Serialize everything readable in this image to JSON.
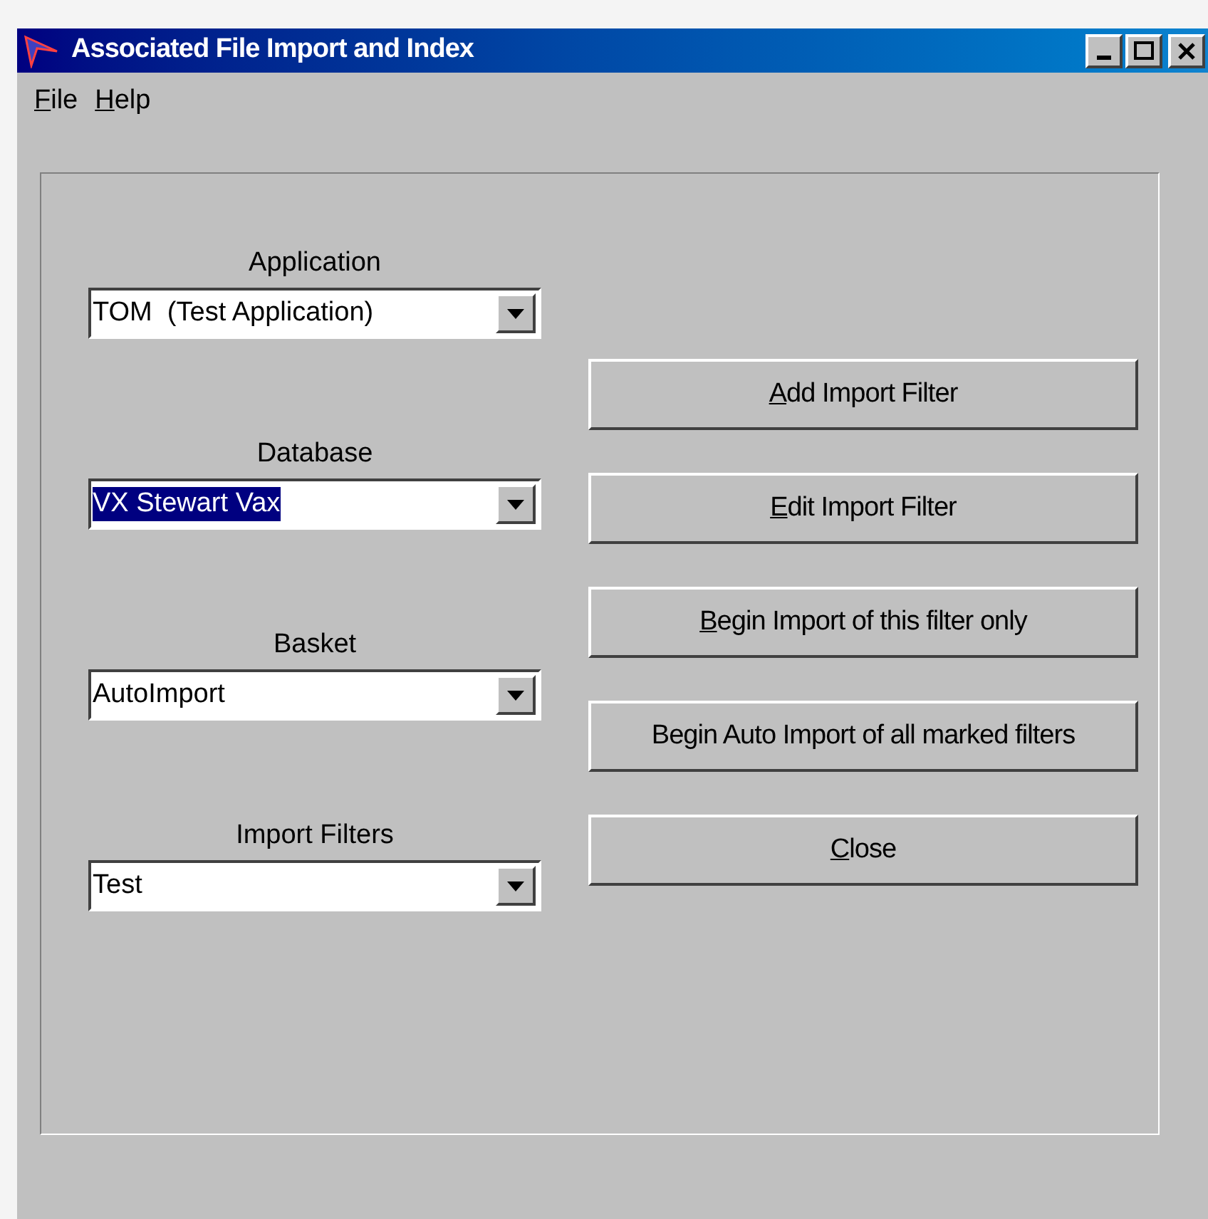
{
  "window": {
    "title": "Associated File Import and Index"
  },
  "menu": [
    {
      "label": "File",
      "mnemonic": true
    },
    {
      "label": "Help",
      "mnemonic": true
    }
  ],
  "fields": [
    {
      "label": "Application",
      "value": "TOM  (Test Application)",
      "selected": false
    },
    {
      "label": "Database",
      "value": "VX Stewart Vax",
      "selected": true
    },
    {
      "label": "Basket",
      "value": "AutoImport",
      "selected": false
    },
    {
      "label": "Import Filters",
      "value": "Test",
      "selected": false
    }
  ],
  "buttons": [
    {
      "label": "Add Import Filter",
      "mnemonic": true
    },
    {
      "label": "Edit Import Filter",
      "mnemonic": true
    },
    {
      "label": "Begin Import of this filter only",
      "mnemonic": true
    },
    {
      "label": "Begin Auto Import of all marked filters",
      "mnemonic": false
    },
    {
      "label": "Close",
      "mnemonic": true
    }
  ]
}
